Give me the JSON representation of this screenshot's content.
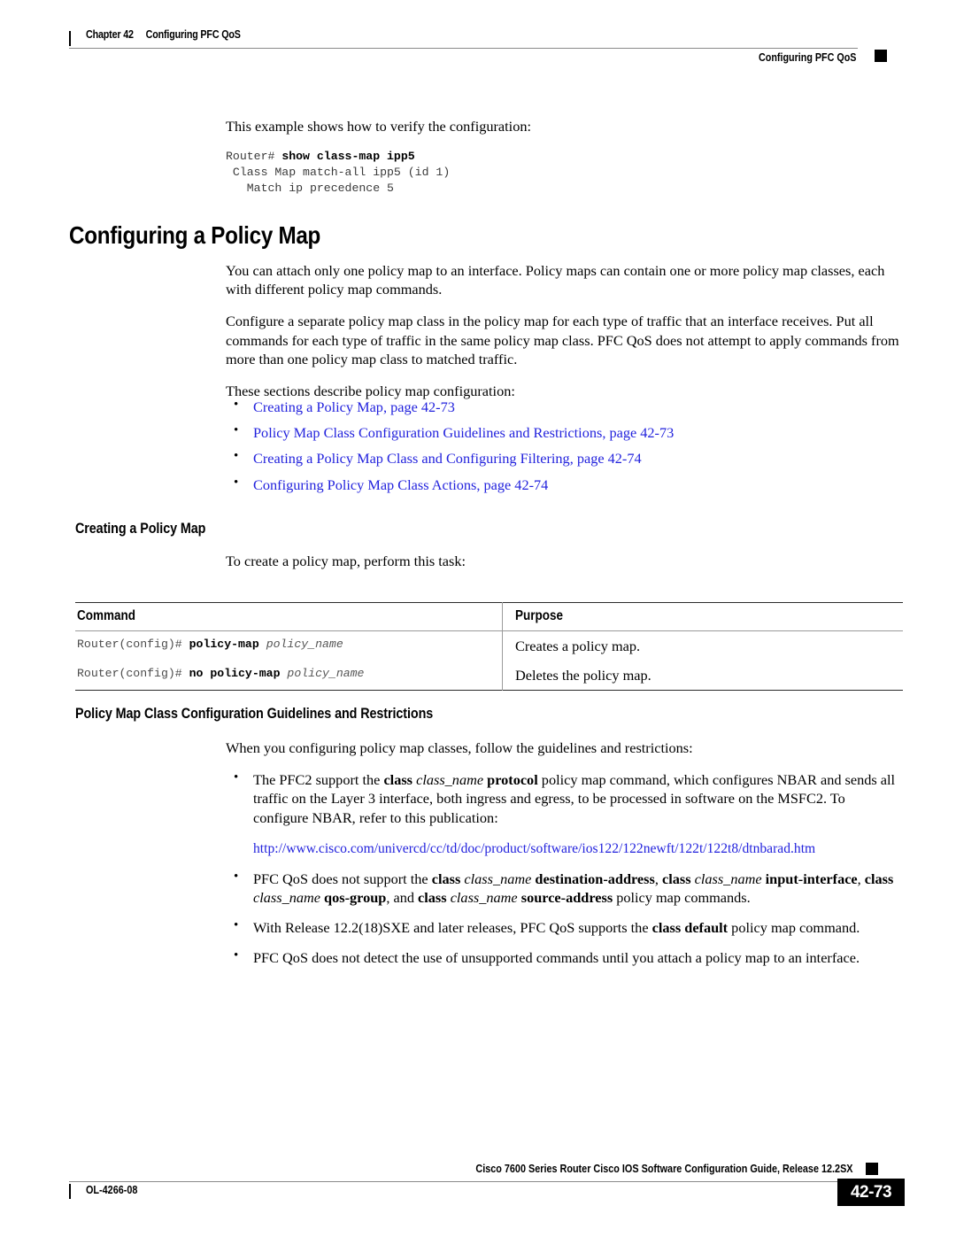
{
  "header": {
    "chapter": "Chapter 42",
    "chapter_title": "Configuring PFC QoS",
    "right_title": "Configuring PFC QoS"
  },
  "intro": {
    "lead": "This example shows how to verify the configuration:",
    "code_prompt": "Router# ",
    "code_command": "show class-map ipp5",
    "code_output": "\n Class Map match-all ipp5 (id 1)\n   Match ip precedence 5"
  },
  "main_heading": "Configuring a Policy Map",
  "paragraphs": {
    "p1": "You can attach only one policy map to an interface. Policy maps can contain one or more policy map classes, each with different policy map commands.",
    "p2": "Configure a separate policy map class in the policy map for each type of traffic that an interface receives. Put all commands for each type of traffic in the same policy map class. PFC QoS does not attempt to apply commands from more than one policy map class to matched traffic.",
    "p3": "These sections describe policy map configuration:"
  },
  "xref_links": [
    "Creating a Policy Map, page 42-73",
    "Policy Map Class Configuration Guidelines and Restrictions, page 42-73",
    "Creating a Policy Map Class and Configuring Filtering, page 42-74",
    "Configuring Policy Map Class Actions, page 42-74"
  ],
  "creating_section": {
    "heading": "Creating a Policy Map",
    "intro": "To create a policy map, perform this task:"
  },
  "table": {
    "headers": [
      "Command",
      "Purpose"
    ],
    "rows": [
      {
        "prompt": "Router(config)# ",
        "keyword": "policy-map ",
        "arg": "policy_name",
        "purpose": "Creates a policy map."
      },
      {
        "prompt": "Router(config)# ",
        "keyword": "no policy-map ",
        "arg": "policy_name",
        "purpose": "Deletes the policy map."
      }
    ]
  },
  "guidelines_section": {
    "heading": "Policy Map Class Configuration Guidelines and Restrictions",
    "intro": "When you configuring policy map classes, follow the guidelines and restrictions:",
    "bullet1": {
      "t1": "The PFC2 support the ",
      "b1": "class",
      "t2": " ",
      "i1": "class_name",
      "t3": " ",
      "b2": "protocol",
      "t4": " policy map command, which configures NBAR and sends all traffic on the Layer 3 interface, both ingress and egress, to be processed in software on the MSFC2. To configure NBAR, refer to this publication:"
    },
    "url": "http://www.cisco.com/univercd/cc/td/doc/product/software/ios122/122newft/122t/122t8/dtnbarad.htm",
    "bullet2": {
      "t1": "PFC QoS does not support the ",
      "b1": "class",
      "i1": "class_name",
      "b2": "destination-address",
      "t2": ", ",
      "b3": "class",
      "i2": "class_name",
      "b4": "input-interface",
      "t3": ", ",
      "b5": "class",
      "i3": "class_name",
      "b6": "qos-group",
      "t4": ", and ",
      "b7": "class",
      "i4": "class_name",
      "b8": "source-address",
      "t5": " policy map commands."
    },
    "bullet3": {
      "t1": "With Release 12.2(18)SXE and later releases, PFC QoS supports the ",
      "b1": "class default",
      "t2": " policy map command."
    },
    "bullet4": "PFC QoS does not detect the use of unsupported commands until you attach a policy map to an interface."
  },
  "footer": {
    "title": "Cisco 7600 Series Router Cisco IOS Software Configuration Guide, Release 12.2SX",
    "doc_id": "OL-4266-08",
    "page_number": "42-73"
  },
  "colors": {
    "link": "#2222dd",
    "rule": "#8a8a8a",
    "table_border": "#2b2b2b"
  }
}
